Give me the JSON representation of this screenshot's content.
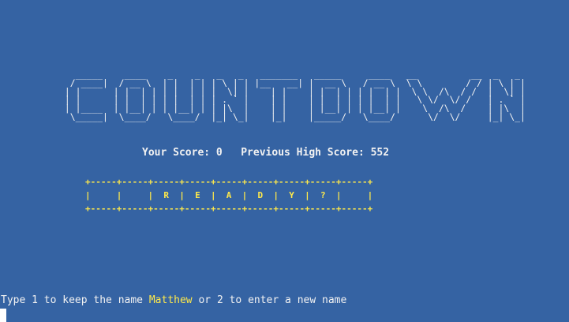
{
  "title_art": [
    "   _____    ____    _    _   _   _   _______   _____     ____   __          __  _   _ ",
    "  / ____|  / __ \\  | |  | | | \\ | | |__   __| |  __ \\   / __ \\  \\ \\        / / | \\ | |",
    " | |      | |  | | | |  | | |  \\| |    | |    | |  | | | |  | |  \\ \\  /\\  / /  |  \\| |",
    " | |      | |  | | | |  | | | . ` |    | |    | |  | | | |  | |   \\ \\/  \\/ /   | . ` |",
    " | |____  | |__| | | |__| | | |\\  |    | |    | |__| | | |__| |    \\  /\\  /    | |\\  |",
    "  \\_____|  \\____/   \\____/  |_| \\_|    |_|    |_____/   \\____/      \\/  \\/     |_| \\_|"
  ],
  "score": {
    "label": "Your Score:",
    "value": "0",
    "high_label": "Previous High Score:",
    "high_value": "552"
  },
  "board": {
    "border": "+-----+-----+-----+-----+-----+-----+-----+-----+-----+",
    "row": "|     |     |  R  |  E  |  A  |  D  |  Y  |  ?  |     |"
  },
  "prompt": {
    "before": "Type 1 to keep the name ",
    "name": "Matthew",
    "after": " or 2 to enter a new name"
  },
  "colors": {
    "background": "#3563a3",
    "text": "#f2f2f2",
    "highlight": "#ffe94a"
  }
}
